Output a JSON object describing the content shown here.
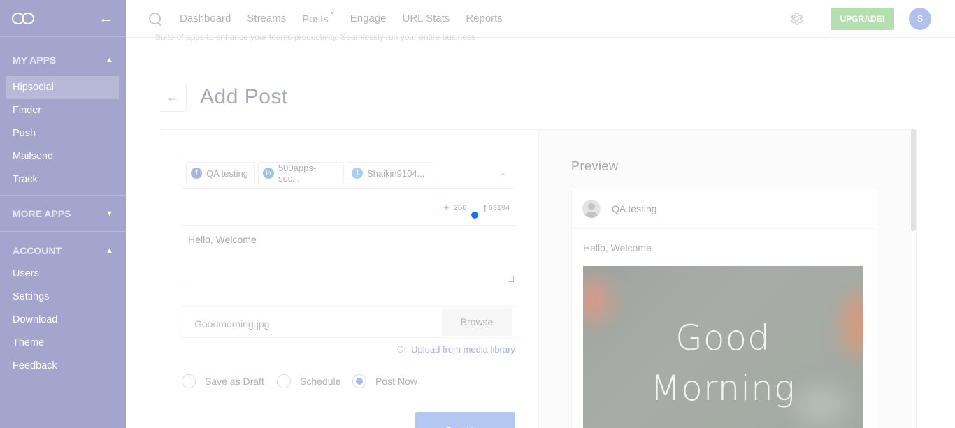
{
  "sidebar": {
    "collapse_icon": "arrow-left-icon",
    "sections": [
      {
        "label": "MY APPS",
        "chevron": "chevron-up-icon"
      },
      {
        "label": "MORE APPS",
        "chevron": "chevron-down-icon"
      },
      {
        "label": "ACCOUNT",
        "chevron": "chevron-up-icon"
      }
    ],
    "my_apps": [
      "Hipsocial",
      "Finder",
      "Push",
      "Mailsend",
      "Track"
    ],
    "account": [
      "Users",
      "Settings",
      "Download",
      "Theme",
      "Feedback"
    ],
    "active_item": "Hipsocial"
  },
  "topbar": {
    "nav": [
      {
        "label": "Dashboard"
      },
      {
        "label": "Streams"
      },
      {
        "label": "Posts",
        "badge": "9"
      },
      {
        "label": "Engage"
      },
      {
        "label": "URL Stats"
      },
      {
        "label": "Reports"
      }
    ],
    "upgrade_label": "UPGRADE!",
    "avatar_initial": "S"
  },
  "page": {
    "subtitle": "Suite of apps to enhance your teams productivity. Seamlessly run your entire business",
    "back_icon": "←",
    "title": "Add Post"
  },
  "composer": {
    "accounts": [
      {
        "network": "facebook",
        "label": "QA testing",
        "color": "#a9b6d6",
        "icon": "f"
      },
      {
        "network": "linkedin",
        "label": "500apps-soc...",
        "color": "#9cc4dd",
        "icon": "in"
      },
      {
        "network": "twitter",
        "label": "Shaikin9104...",
        "color": "#a8cfec",
        "icon": "t"
      }
    ],
    "twitter_count": "266",
    "facebook_count": "63194",
    "message": "Hello, Welcome",
    "file_name": "Goodmorning.jpg",
    "browse_label": "Browse",
    "or_text": "Or",
    "upload_link": "Upload from media library",
    "options": [
      {
        "label": "Save as Draft",
        "checked": false
      },
      {
        "label": "Schedule",
        "checked": false
      },
      {
        "label": "Post Now",
        "checked": true
      }
    ],
    "submit_label": "Post Now"
  },
  "preview": {
    "title": "Preview",
    "account_name": "QA testing",
    "text": "Hello, Welcome",
    "image_line1": "Good",
    "image_line2": "Morning"
  }
}
